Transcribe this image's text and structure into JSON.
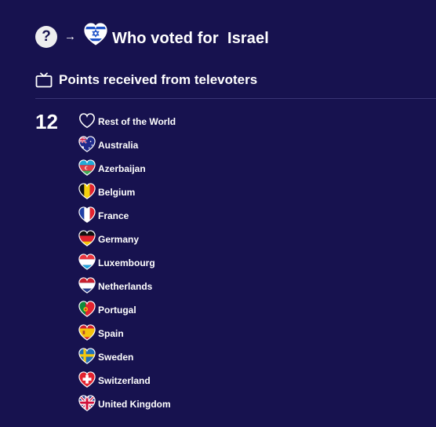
{
  "header": {
    "help_glyph": "?",
    "arrow_glyph": "→",
    "title": "Who voted for  Israel",
    "country_flag_icon": "israel-flag-heart-icon"
  },
  "section": {
    "icon": "tv-icon",
    "title": "Points received from televoters"
  },
  "points_group": {
    "points": "12",
    "countries": [
      {
        "name": "Rest of the World",
        "icon": "heart-outline-icon"
      },
      {
        "name": "Australia",
        "icon": "australia-flag-heart-icon"
      },
      {
        "name": "Azerbaijan",
        "icon": "azerbaijan-flag-heart-icon"
      },
      {
        "name": "Belgium",
        "icon": "belgium-flag-heart-icon"
      },
      {
        "name": "France",
        "icon": "france-flag-heart-icon"
      },
      {
        "name": "Germany",
        "icon": "germany-flag-heart-icon"
      },
      {
        "name": "Luxembourg",
        "icon": "luxembourg-flag-heart-icon"
      },
      {
        "name": "Netherlands",
        "icon": "netherlands-flag-heart-icon"
      },
      {
        "name": "Portugal",
        "icon": "portugal-flag-heart-icon"
      },
      {
        "name": "Spain",
        "icon": "spain-flag-heart-icon"
      },
      {
        "name": "Sweden",
        "icon": "sweden-flag-heart-icon"
      },
      {
        "name": "Switzerland",
        "icon": "switzerland-flag-heart-icon"
      },
      {
        "name": "United Kingdom",
        "icon": "united-kingdom-flag-heart-icon"
      }
    ]
  },
  "colors": {
    "background": "#17124f",
    "text": "#ffffff",
    "divider": "#3a3574"
  }
}
